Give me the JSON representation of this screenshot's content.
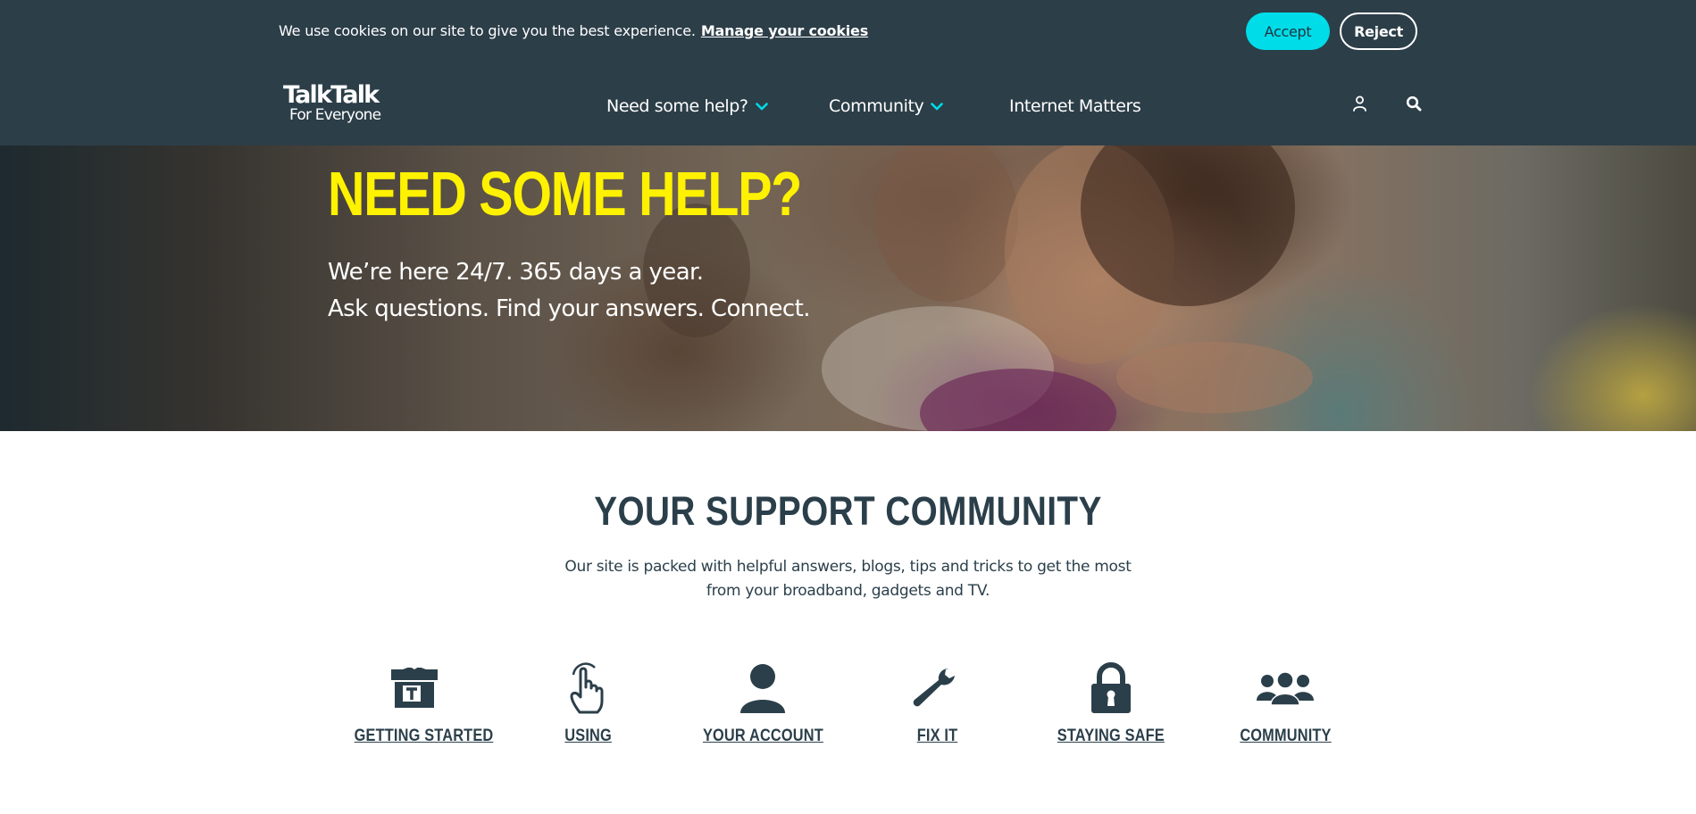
{
  "cookie_bar": {
    "message": "We use cookies on our site to give you the best experience.",
    "manage_link": "Manage your cookies",
    "accept_label": "Accept",
    "reject_label": "Reject"
  },
  "header": {
    "logo_main": "TalkTalk",
    "logo_sub": "For Everyone",
    "nav": [
      {
        "label": "Need some help?",
        "has_dropdown": true
      },
      {
        "label": "Community",
        "has_dropdown": true
      },
      {
        "label": "Internet Matters",
        "has_dropdown": false
      }
    ],
    "icons": [
      "user-icon",
      "search-icon"
    ]
  },
  "hero": {
    "title": "NEED SOME HELP?",
    "line1": "We’re here 24/7. 365 days a year.",
    "line2": "Ask questions. Find your answers. Connect."
  },
  "support": {
    "title": "YOUR SUPPORT COMMUNITY",
    "desc_line1": "Our site is packed with helpful answers, blogs, tips and tricks to get the most",
    "desc_line2": "from your broadband, gadgets and TV.",
    "categories": [
      {
        "label": "GETTING STARTED",
        "icon": "box-icon"
      },
      {
        "label": "USING",
        "icon": "pointer-hand-icon"
      },
      {
        "label": "YOUR ACCOUNT",
        "icon": "person-icon"
      },
      {
        "label": "FIX IT",
        "icon": "wrench-icon"
      },
      {
        "label": "STAYING SAFE",
        "icon": "padlock-icon"
      },
      {
        "label": "COMMUNITY",
        "icon": "group-icon"
      }
    ]
  },
  "colors": {
    "header_bg": "#2c3e48",
    "accent": "#00dce8",
    "hero_title": "#fff200",
    "text_dark": "#2b3f4a"
  }
}
